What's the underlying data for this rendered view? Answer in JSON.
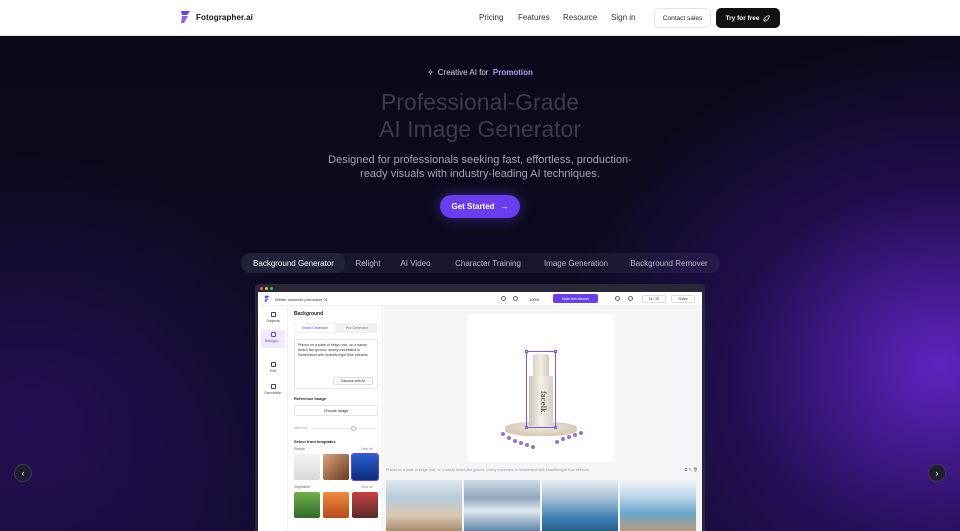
{
  "nav": {
    "brand": "Fotographer.ai",
    "links": [
      "Pricing",
      "Features",
      "Resource",
      "Sign in"
    ],
    "contact_label": "Contact sales",
    "try_label": "Try for free"
  },
  "hero": {
    "eyebrow_prefix": "Creative AI for",
    "eyebrow_accent": "Promotion",
    "title_line1": "Professional-Grade",
    "title_line2": "AI Image Generator",
    "subtitle_line1": "Designed for professionals seeking fast, effortless, production-",
    "subtitle_line2": "ready visuals with industry-leading AI techniques.",
    "cta_label": "Get Started"
  },
  "tabs": [
    {
      "label": "Background Generator",
      "active": true
    },
    {
      "label": "Relight",
      "active": false
    },
    {
      "label": "AI Video",
      "active": false
    },
    {
      "label": "Character Training",
      "active": false
    },
    {
      "label": "Image Generation",
      "active": false
    },
    {
      "label": "Background Remover",
      "active": false
    }
  ],
  "carousel": {
    "prev_icon": "chevron-left-icon",
    "next_icon": "chevron-right-icon"
  },
  "app": {
    "project_name": "Winter cosmetic promotion 01",
    "zoom": "100%",
    "make_label": "Make this Banner",
    "counter": "11 / 20",
    "share_label": "Share",
    "rail": [
      "Subjects",
      "Backgro...",
      "Edit",
      "Decoration"
    ],
    "panel": {
      "heading": "Background",
      "seg_a": "Smart Generator",
      "seg_b": "Pro Generator",
      "prompt": "Placed on a plate of beige rock, on a sandy beach like ground, snowy mountains in Switzerland with beautiful light blue streams",
      "discuss_label": "Discuss with AI",
      "ref_label": "Reference Image",
      "choose_label": "Choose Image",
      "effect_label": "Affection",
      "templates_label": "Select from templates",
      "group_simple": "Simple",
      "group_vegetable": "Vegetable",
      "view_all": "View all"
    },
    "canvas": {
      "product_label": "facelk",
      "caption": "Placed on a plate of beige rock, on a sandy beach like ground, snowy mountains in Switzerland with beautiful light blue streams"
    }
  },
  "colors": {
    "accent": "#6a3df0",
    "accent_text": "#b79bff"
  }
}
